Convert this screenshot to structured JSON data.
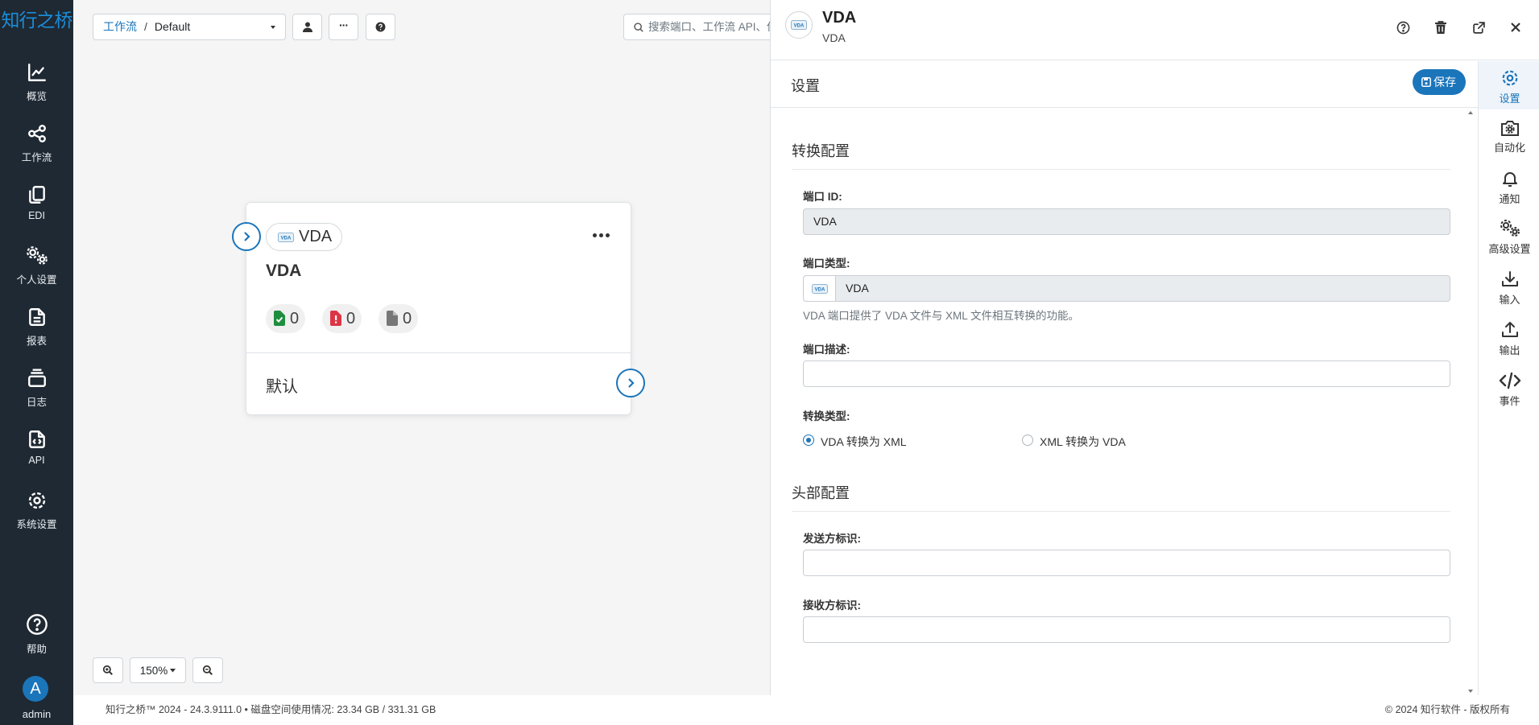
{
  "sidebar": {
    "logo": "知行之桥",
    "items": [
      {
        "label": "概览",
        "icon": "chart-line-icon"
      },
      {
        "label": "工作流",
        "icon": "share-nodes-icon"
      },
      {
        "label": "EDI",
        "icon": "copy-icon"
      },
      {
        "label": "个人设置",
        "icon": "gears-icon"
      },
      {
        "label": "报表",
        "icon": "file-lines-icon"
      },
      {
        "label": "日志",
        "icon": "layers-icon"
      },
      {
        "label": "API",
        "icon": "file-code-icon"
      },
      {
        "label": "系统设置",
        "icon": "gear-icon"
      }
    ],
    "help_label": "帮助",
    "avatar_letter": "A",
    "user_name": "admin"
  },
  "toolbar": {
    "breadcrumb_root": "工作流",
    "breadcrumb_sep": "/",
    "breadcrumb_current": "Default",
    "more_label": "···",
    "search_placeholder": "搜索端口、工作流 API、保"
  },
  "port_card": {
    "chip_label": "VDA",
    "title": "VDA",
    "stats": {
      "success": "0",
      "error": "0",
      "pending": "0"
    },
    "footer_label": "默认"
  },
  "zoom": {
    "level": "150%"
  },
  "footer": {
    "left": "知行之桥™ 2024 - 24.3.9111.0 • 磁盘空间使用情况: 23.34 GB / 331.31 GB",
    "right": "© 2024 知行软件 - 版权所有"
  },
  "panel": {
    "title": "VDA",
    "subtitle": "VDA",
    "logo_text": "VDA",
    "settings_title": "设置",
    "save_label": "保存",
    "sections": {
      "conversion": "转换配置",
      "header": "头部配置"
    },
    "fields": {
      "port_id_label": "端口 ID:",
      "port_id_value": "VDA",
      "port_type_label": "端口类型:",
      "port_type_value": "VDA",
      "port_type_help": "VDA 端口提供了 VDA 文件与 XML 文件相互转换的功能。",
      "port_desc_label": "端口描述:",
      "port_desc_value": "",
      "conv_type_label": "转换类型:",
      "radio_vda_to_xml": "VDA 转换为 XML",
      "radio_xml_to_vda": "XML 转换为 VDA",
      "selected_conversion": "VDA 转换为 XML",
      "sender_label": "发送方标识:",
      "sender_value": "",
      "receiver_label": "接收方标识:",
      "receiver_value": ""
    }
  },
  "rail": {
    "items": [
      {
        "label": "设置",
        "icon": "gear-icon"
      },
      {
        "label": "自动化",
        "icon": "camera-gear-icon"
      },
      {
        "label": "通知",
        "icon": "bell-icon"
      },
      {
        "label": "高级设置",
        "icon": "gears-icon"
      },
      {
        "label": "输入",
        "icon": "download-icon"
      },
      {
        "label": "输出",
        "icon": "upload-icon"
      },
      {
        "label": "事件",
        "icon": "code-icon"
      }
    ]
  },
  "colors": {
    "accent": "#1b75bb",
    "sidebar": "#1f2933",
    "success": "#1e8e3e",
    "error": "#dc3545",
    "neutral": "#777777"
  }
}
